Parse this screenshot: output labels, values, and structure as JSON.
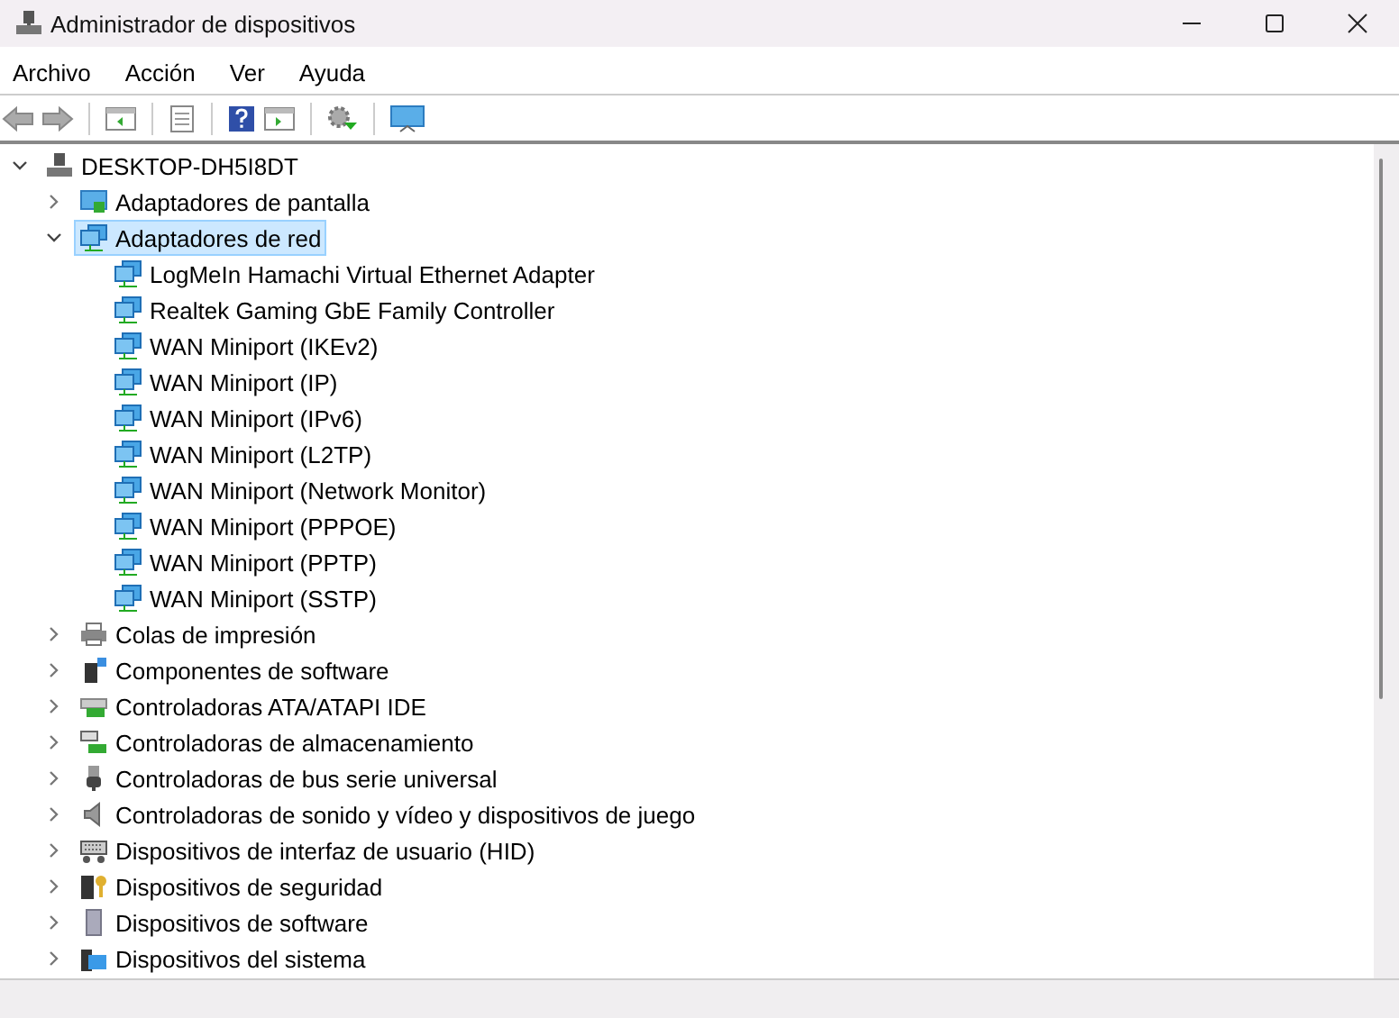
{
  "window": {
    "title": "Administrador de dispositivos"
  },
  "menu": [
    {
      "label": "Archivo"
    },
    {
      "label": "Acción"
    },
    {
      "label": "Ver"
    },
    {
      "label": "Ayuda"
    }
  ],
  "tree": {
    "label": "DESKTOP-DH5I8DT",
    "expanded": true,
    "selected": false,
    "children": [
      {
        "label": "Adaptadores de pantalla",
        "expanded": false,
        "selected": false
      },
      {
        "label": "Adaptadores de red",
        "expanded": true,
        "selected": true,
        "children": [
          {
            "label": "LogMeIn Hamachi Virtual Ethernet Adapter",
            "selected": false
          },
          {
            "label": "Realtek Gaming GbE Family Controller",
            "selected": false
          },
          {
            "label": "WAN Miniport (IKEv2)",
            "selected": false
          },
          {
            "label": "WAN Miniport (IP)",
            "selected": false
          },
          {
            "label": "WAN Miniport (IPv6)",
            "selected": false
          },
          {
            "label": "WAN Miniport (L2TP)",
            "selected": false
          },
          {
            "label": "WAN Miniport (Network Monitor)",
            "selected": false
          },
          {
            "label": "WAN Miniport (PPPOE)",
            "selected": false
          },
          {
            "label": "WAN Miniport (PPTP)",
            "selected": false
          },
          {
            "label": "WAN Miniport (SSTP)",
            "selected": false
          }
        ]
      },
      {
        "label": "Colas de impresión",
        "expanded": false,
        "selected": false
      },
      {
        "label": "Componentes de software",
        "expanded": false,
        "selected": false
      },
      {
        "label": "Controladoras ATA/ATAPI IDE",
        "expanded": false,
        "selected": false
      },
      {
        "label": "Controladoras de almacenamiento",
        "expanded": false,
        "selected": false
      },
      {
        "label": "Controladoras de bus serie universal",
        "expanded": false,
        "selected": false
      },
      {
        "label": "Controladoras de sonido y vídeo y dispositivos de juego",
        "expanded": false,
        "selected": false
      },
      {
        "label": "Dispositivos de interfaz de usuario (HID)",
        "expanded": false,
        "selected": false
      },
      {
        "label": "Dispositivos de seguridad",
        "expanded": false,
        "selected": false
      },
      {
        "label": "Dispositivos de software",
        "expanded": false,
        "selected": false
      },
      {
        "label": "Dispositivos del sistema",
        "expanded": false,
        "selected": false
      }
    ]
  }
}
